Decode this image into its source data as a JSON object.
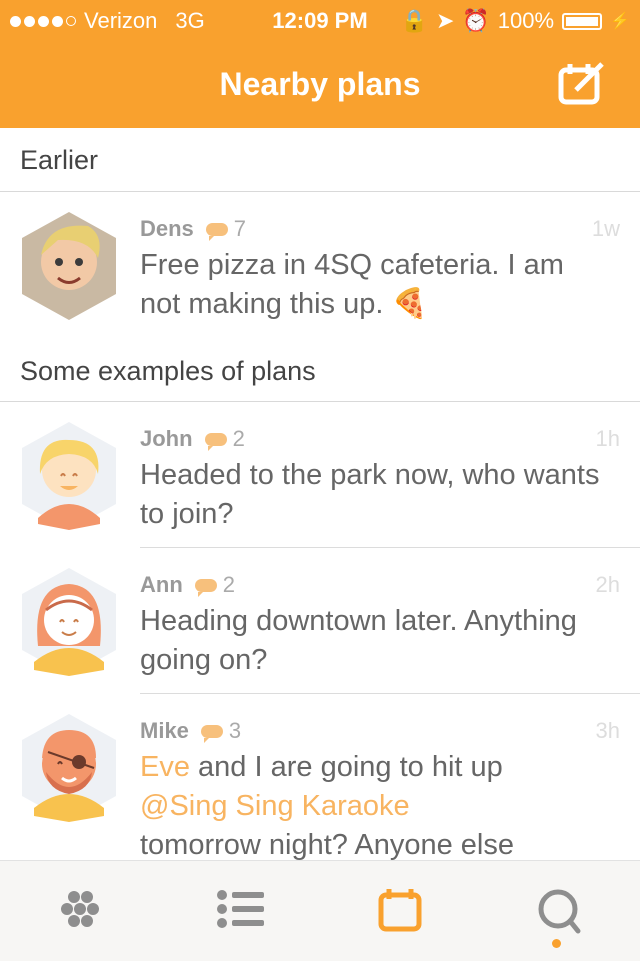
{
  "status": {
    "carrier": "Verizon",
    "network": "3G",
    "time": "12:09 PM",
    "battery": "100%"
  },
  "nav": {
    "title": "Nearby plans"
  },
  "sections": {
    "earlier": "Earlier",
    "examples": "Some examples of plans"
  },
  "plans": [
    {
      "name": "Dens",
      "comments": "7",
      "age": "1w",
      "text": "Free pizza in 4SQ cafeteria. I am not making this up.",
      "emoji": "🍕"
    },
    {
      "name": "John",
      "comments": "2",
      "age": "1h",
      "text": "Headed to the park now, who wants to join?"
    },
    {
      "name": "Ann",
      "comments": "2",
      "age": "2h",
      "text": "Heading downtown later. Anything going on?"
    },
    {
      "name": "Mike",
      "comments": "3",
      "age": "3h",
      "mention_user": "Eve",
      "text_mid": " and I are going to hit up",
      "mention_place": "@Sing Sing Karaoke",
      "text_end": "tomorrow night? Anyone else"
    }
  ],
  "tabs": [
    {
      "icon": "hex-dots-icon"
    },
    {
      "icon": "list-icon"
    },
    {
      "icon": "calendar-icon",
      "active": true
    },
    {
      "icon": "search-icon"
    }
  ],
  "colors": {
    "accent": "#F9A12E",
    "highlight": "#F8B461"
  }
}
